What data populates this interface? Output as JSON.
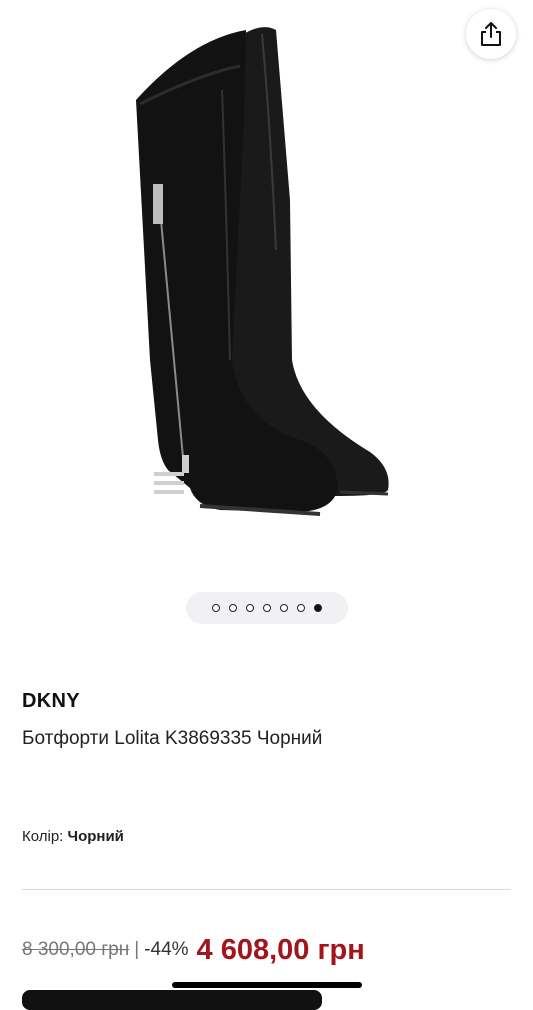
{
  "product": {
    "brand": "DKNY",
    "title": "Ботфорти Lolita K3869335 Чорний",
    "image_alt": "boot-product-image"
  },
  "gallery": {
    "count": 7,
    "active_index": 6
  },
  "color": {
    "label": "Колір:",
    "value": "Чорний"
  },
  "price": {
    "old": "8 300,00 грн",
    "separator": "|",
    "discount": "-44%",
    "current": "4 608,00 грн"
  },
  "colors": {
    "accent": "#a3141b",
    "text": "#111111"
  },
  "icons": {
    "share": "share-icon"
  }
}
